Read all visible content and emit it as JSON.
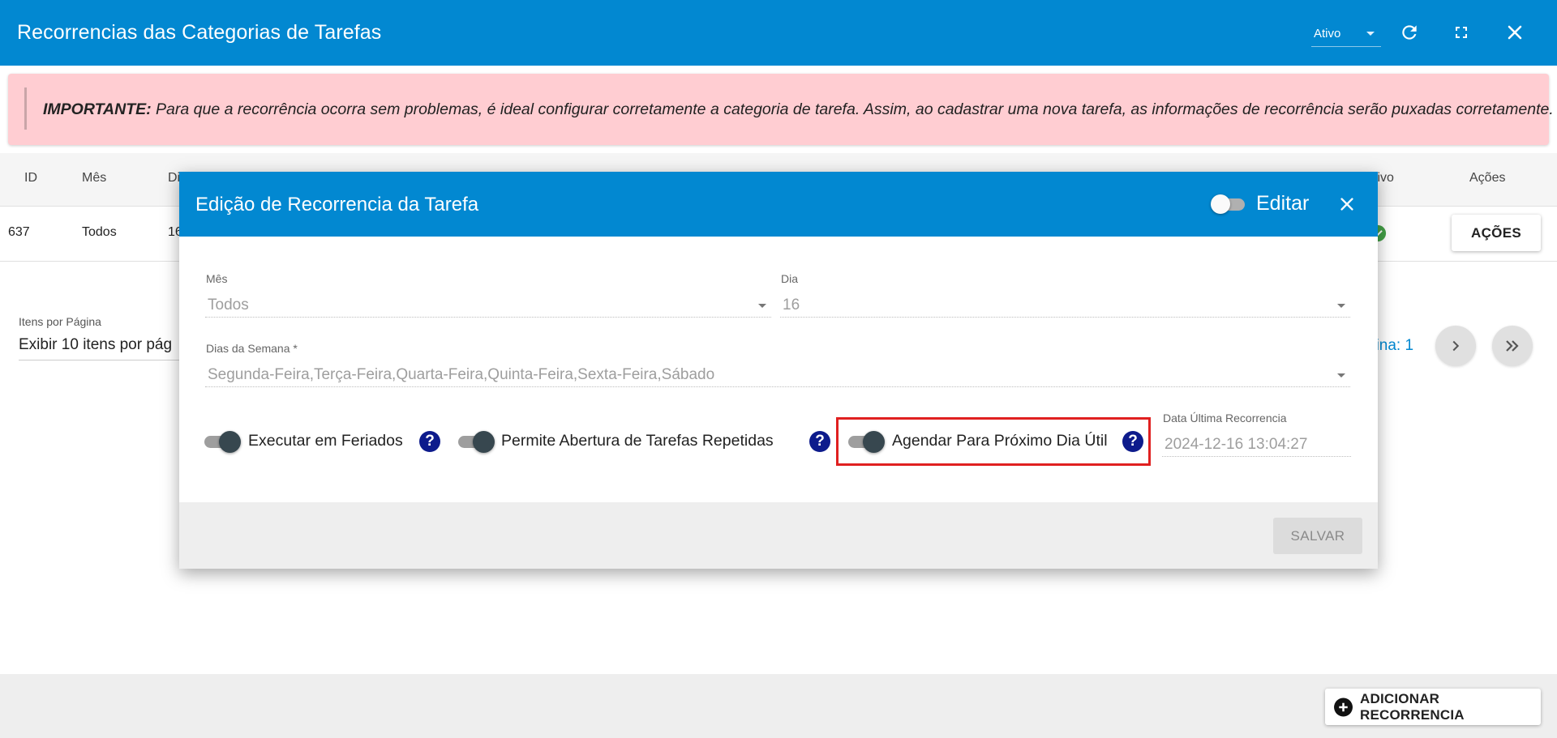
{
  "header": {
    "title": "Recorrencias das Categorias de Tarefas",
    "status_value": "Ativo"
  },
  "warning": {
    "strong": "IMPORTANTE:",
    "text": " Para que a recorrência ocorra sem problemas, é ideal configurar corretamente a categoria de tarefa. Assim, ao cadastrar uma nova tarefa, as informações de recorrência serão puxadas corretamente."
  },
  "table": {
    "columns": {
      "id": "ID",
      "mes": "Mês",
      "dia_partial": "Di",
      "ativo_partial": "tivo",
      "acoes": "Ações"
    },
    "row": {
      "id": "637",
      "mes": "Todos",
      "dia_partial": "16"
    },
    "row_action_label": "AÇÕES"
  },
  "pagination": {
    "items_label": "Itens por Página",
    "items_value": "Exibir 10 itens por pág",
    "page_label": "gina: 1"
  },
  "footer": {
    "add_label": "ADICIONAR RECORRENCIA"
  },
  "modal": {
    "title": "Edição de Recorrencia da Tarefa",
    "edit_label": "Editar",
    "mes": {
      "label": "Mês",
      "value": "Todos"
    },
    "dia": {
      "label": "Dia",
      "value": "16"
    },
    "dias_semana": {
      "label": "Dias da Semana *",
      "value": "Segunda-Feira,Terça-Feira,Quarta-Feira,Quinta-Feira,Sexta-Feira,Sábado"
    },
    "toggles": {
      "feriados": "Executar em Feriados",
      "repetidas": "Permite Abertura de Tarefas Repetidas",
      "proximo_dia_util": "Agendar Para Próximo Dia Útil"
    },
    "ultima_recorrencia": {
      "label": "Data Última Recorrencia",
      "value": "2024-12-16 13:04:27"
    },
    "save_label": "SALVAR"
  },
  "colors": {
    "primary": "#0288d1",
    "warning_bg": "#ffcdd2",
    "help_icon": "#0d1b8c",
    "highlight": "#e02020",
    "success": "#43a047"
  }
}
